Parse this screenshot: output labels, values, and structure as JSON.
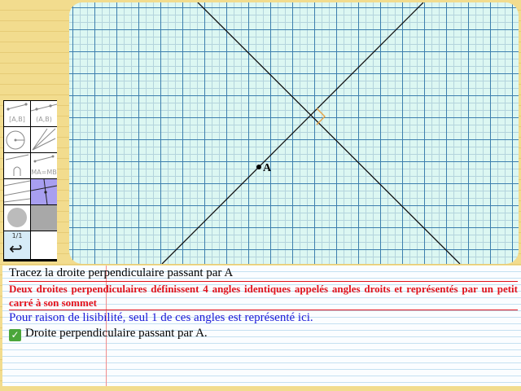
{
  "board": {
    "point_label": "A"
  },
  "palette": {
    "tools": [
      {
        "id": "segment",
        "label": "[A,B]"
      },
      {
        "id": "ray",
        "label": "(A,B)"
      },
      {
        "id": "circle",
        "label": ""
      },
      {
        "id": "lines",
        "label": ""
      },
      {
        "id": "arc",
        "label": ""
      },
      {
        "id": "equal-distance",
        "label": "MA=MB"
      },
      {
        "id": "parallel",
        "label": ""
      },
      {
        "id": "perpendicular",
        "label": "",
        "active": true
      },
      {
        "id": "fill",
        "label": ""
      },
      {
        "id": "grey",
        "label": ""
      }
    ],
    "page_indicator": "1/1",
    "undo_glyph": "↩"
  },
  "instructions": {
    "title": "Tracez la droite perpendiculaire passant par A",
    "note": "Deux droites perpendiculaires définissent 4 angles identiques appelés angles droits et représentés par un petit carré à son sommet",
    "hint": "Pour raison de lisibilité, seul 1 de ces angles est représenté ici.",
    "task": "Droite perpendiculaire passant par A.",
    "task_done": true
  },
  "colors": {
    "note_red": "#e3121b",
    "hint_blue": "#1a1ad8",
    "grid_major": "#3d7fae",
    "grid_minor": "#b4d4dd",
    "board_bg": "#dcf7f2",
    "active_tool": "#a89ff0",
    "right_angle_marker": "#e8a040",
    "check_green": "#4aa63a"
  }
}
